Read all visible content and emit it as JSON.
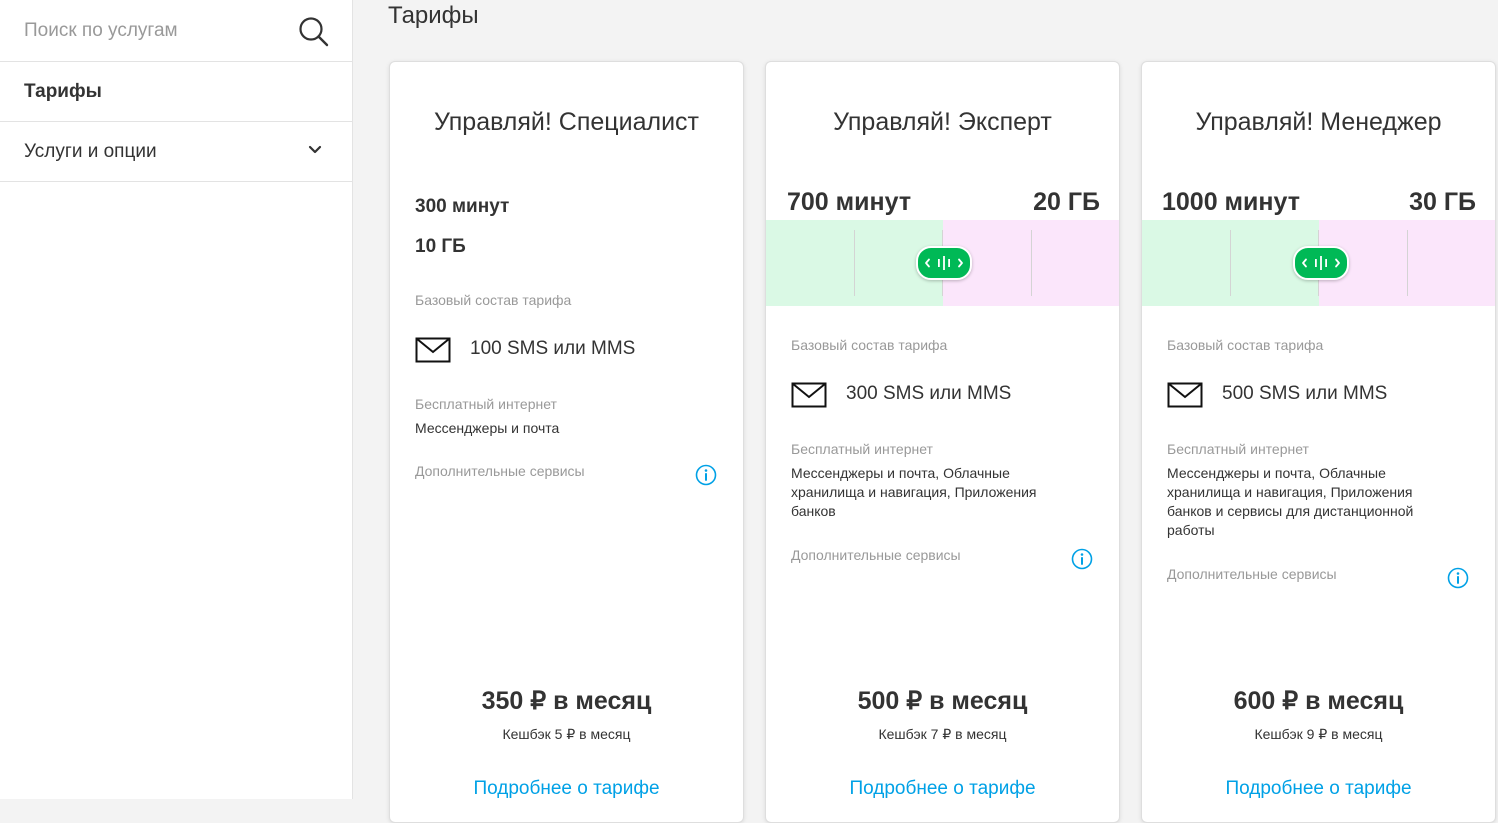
{
  "search": {
    "placeholder": "Поиск по услугам"
  },
  "sidebar": {
    "items": [
      {
        "label": "Тарифы"
      },
      {
        "label": "Услуги и опции"
      }
    ]
  },
  "page": {
    "title": "Тарифы"
  },
  "colors": {
    "accent": "#00b956",
    "link": "#00a1e6",
    "slider_minutes": "#daf9e5",
    "slider_gb": "#fbe6fb"
  },
  "labels": {
    "base": "Базовый состав тарифа",
    "free_internet": "Бесплатный интернет",
    "extra": "Дополнительные сервисы"
  },
  "cards": [
    {
      "title": "Управляй! Специалист",
      "minutes": "300 минут",
      "gb": "10 ГБ",
      "sms": "100 SMS или MMS",
      "free_internet": "Мессенджеры и почта",
      "price": "350 ₽ в месяц",
      "cashback": "Кешбэк 5 ₽ в месяц",
      "link": "Подробнее о тарифе"
    },
    {
      "title": "Управляй! Эксперт",
      "minutes": "700 минут",
      "gb": "20 ГБ",
      "sms": "300 SMS или MMS",
      "free_internet": "Мессенджеры и почта, Облачные хранилища и навигация, Приложения банков",
      "price": "500 ₽ в месяц",
      "cashback": "Кешбэк 7 ₽ в месяц",
      "link": "Подробнее о тарифе"
    },
    {
      "title": "Управляй! Менеджер",
      "minutes": "1000 минут",
      "gb": "30 ГБ",
      "sms": "500 SMS или MMS",
      "free_internet": "Мессенджеры и почта, Облачные хранилища и навигация, Приложения банков и сервисы для дистанционной работы",
      "price": "600 ₽ в месяц",
      "cashback": "Кешбэк 9 ₽ в месяц",
      "link": "Подробнее о тарифе"
    }
  ]
}
